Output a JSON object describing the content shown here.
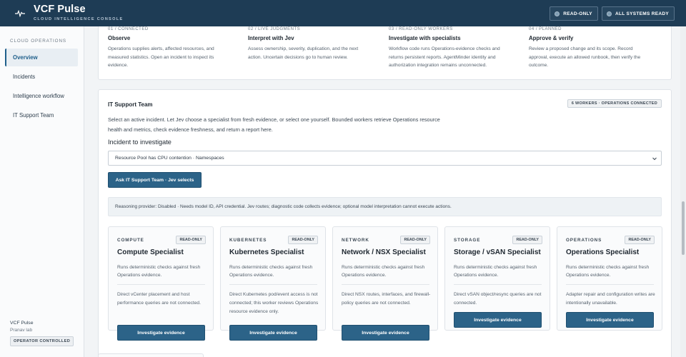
{
  "header": {
    "title": "VCF Pulse",
    "subtitle": "CLOUD INTELLIGENCE CONSOLE",
    "actions": [
      "READ-ONLY",
      "ALL SYSTEMS READY"
    ]
  },
  "sidebar": {
    "heading": "CLOUD OPERATIONS",
    "items": [
      {
        "label": "Overview",
        "active": true
      },
      {
        "label": "Incidents",
        "active": false
      },
      {
        "label": "Intelligence workflow",
        "active": false
      },
      {
        "label": "IT Support Team",
        "active": false
      }
    ],
    "footer": {
      "app": "VCF Pulse",
      "user": "Pranav lab",
      "badge": "OPERATOR CONTROLLED"
    }
  },
  "steps": [
    {
      "eyebrow": "01 / CONNECTED",
      "title": "Observe",
      "desc": "Operations supplies alerts, affected resources, and measured statistics. Open an incident to inspect its evidence."
    },
    {
      "eyebrow": "02 / LIVE JUDGMENTS",
      "title": "Interpret with Jev",
      "desc": "Assess ownership, severity, duplication, and the next action. Uncertain decisions go to human review."
    },
    {
      "eyebrow": "03 / READ-ONLY WORKERS",
      "title": "Investigate with specialists",
      "desc": "Workflow code runs Operations-evidence checks and returns persistent reports. AgentMinder identity and authorization integration remains unconnected."
    },
    {
      "eyebrow": "04 / PLANNED",
      "title": "Approve & verify",
      "desc": "Review a proposed change and its scope. Record approval, execute an allowed runbook, then verify the outcome."
    }
  ],
  "team": {
    "title": "IT Support Team",
    "badge": "6 WORKERS · OPERATIONS CONNECTED",
    "desc": "Select an active incident. Let Jev choose a specialist from fresh evidence, or select one yourself. Bounded workers retrieve Operations resource health and metrics, check evidence freshness, and return a report here.",
    "incident_label": "Incident to investigate",
    "incident_value": "Resource Pool has CPU contention · Namespaces",
    "ask_button": "Ask IT Support Team · Jev selects",
    "reasoning": "Reasoning provider: Disabled · Needs model ID, API credential. Jev routes; diagnostic code collects evidence; optional model interpretation cannot execute actions."
  },
  "specialists": [
    {
      "domain": "COMPUTE",
      "badge": "READ-ONLY",
      "name": "Compute Specialist",
      "desc": "Runs deterministic checks against fresh Operations evidence.",
      "note": "Direct vCenter placement and host performance queries are not connected.",
      "button": "Investigate evidence"
    },
    {
      "domain": "KUBERNETES",
      "badge": "READ-ONLY",
      "name": "Kubernetes Specialist",
      "desc": "Runs deterministic checks against fresh Operations evidence.",
      "note": "Direct Kubernetes pod/event access is not connected; this worker reviews Operations resource evidence only.",
      "button": "Investigate evidence"
    },
    {
      "domain": "NETWORK",
      "badge": "READ-ONLY",
      "name": "Network / NSX Specialist",
      "desc": "Runs deterministic checks against fresh Operations evidence.",
      "note": "Direct NSX routes, interfaces, and firewall-policy queries are not connected.",
      "button": "Investigate evidence"
    },
    {
      "domain": "STORAGE",
      "badge": "READ-ONLY",
      "name": "Storage / vSAN Specialist",
      "desc": "Runs deterministic checks against fresh Operations evidence.",
      "note": "Direct vSAN object/resync queries are not connected.",
      "button": "Investigate evidence"
    },
    {
      "domain": "OPERATIONS",
      "badge": "READ-ONLY",
      "name": "Operations Specialist",
      "desc": "Runs deterministic checks against fresh Operations evidence.",
      "note": "Adapter repair and configuration writes are intentionally unavailable.",
      "button": "Investigate evidence"
    }
  ]
}
